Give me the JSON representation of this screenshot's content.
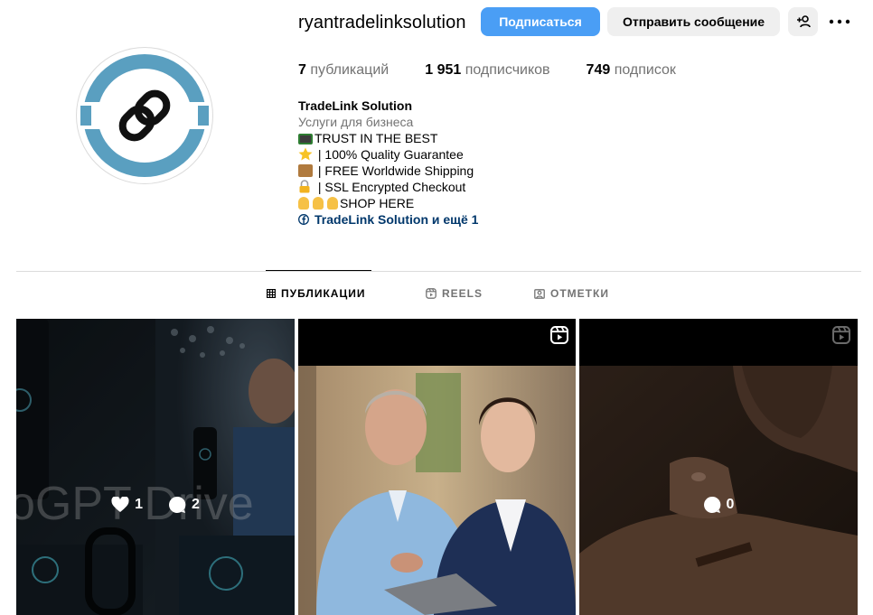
{
  "profile": {
    "username": "ryantradelinksolution",
    "follow_label": "Подписаться",
    "message_label": "Отправить сообщение",
    "stats": {
      "posts_count": "7",
      "posts_label": "публикаций",
      "followers_count": "1 951",
      "followers_label": "подписчиков",
      "following_count": "749",
      "following_label": "подписок"
    },
    "bio": {
      "name": "TradeLink Solution",
      "category": "Услуги для бизнеса",
      "lines": [
        "TRUST IN THE BEST",
        " | 100% Quality Guarantee",
        " | FREE Worldwide Shipping",
        " | SSL Encrypted Checkout",
        "SHOP HERE"
      ],
      "link_text": "TradeLink Solution и ещё 1"
    }
  },
  "tabs": [
    {
      "label": "ПУБЛИКАЦИИ",
      "icon": "grid-icon",
      "active": true
    },
    {
      "label": "REELS",
      "icon": "reels-icon",
      "active": false
    },
    {
      "label": "ОТМЕТКИ",
      "icon": "tagged-icon",
      "active": false
    }
  ],
  "posts": [
    {
      "likes": "1",
      "comments": "2",
      "overlay_text": "oGPT Drive"
    },
    {
      "type": "reel"
    },
    {
      "type": "reel",
      "comments": "0"
    }
  ],
  "colors": {
    "follow_button": "#4a9ef5",
    "secondary_button": "#efefef",
    "link": "#00376b",
    "muted_text": "#737373",
    "avatar_ring": "#5a9fc0"
  }
}
